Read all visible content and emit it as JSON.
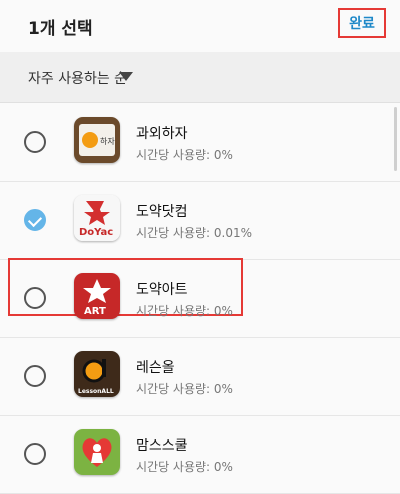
{
  "header": {
    "title": "1개 선택",
    "done_label": "완료"
  },
  "sort": {
    "label": "자주 사용하는 순"
  },
  "apps": [
    {
      "name": "과외하자",
      "usage": "시간당 사용량: 0%",
      "checked": false
    },
    {
      "name": "도약닷컴",
      "usage": "시간당 사용량: 0.01%",
      "checked": true
    },
    {
      "name": "도약아트",
      "usage": "시간당 사용량: 0%",
      "checked": false
    },
    {
      "name": "레슨올",
      "usage": "시간당 사용량: 0%",
      "checked": false
    },
    {
      "name": "맘스스쿨",
      "usage": "시간당 사용량: 0%",
      "checked": false
    }
  ],
  "icon_text": {
    "doyac": "DoYac",
    "art": "ART",
    "lessonall": "LessonALL",
    "tutor": "하자"
  },
  "colors": {
    "accent": "#1e88c8",
    "checked": "#64b5e8",
    "highlight": "#e53935"
  }
}
